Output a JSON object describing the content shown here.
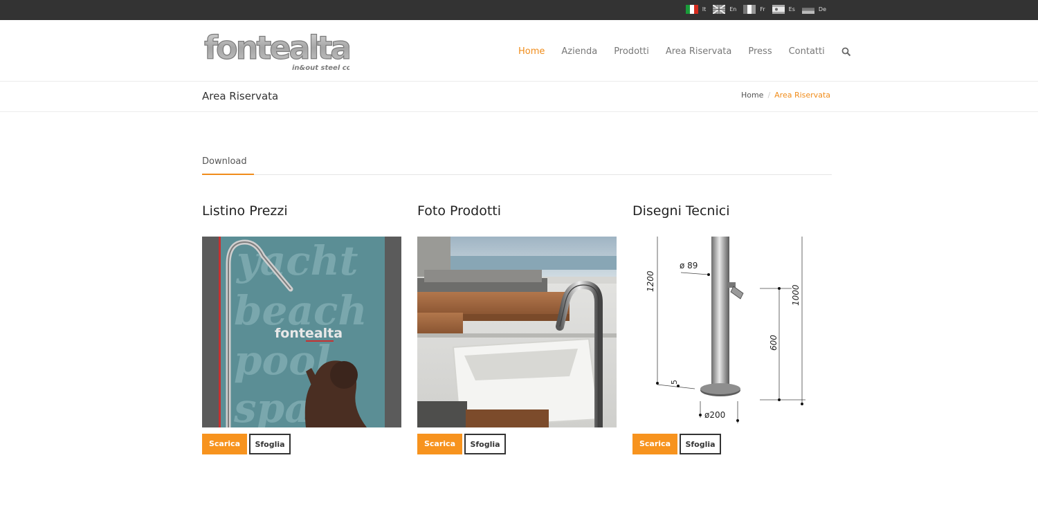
{
  "languages": [
    {
      "code": "It",
      "icon": "italy-flag-icon"
    },
    {
      "code": "En",
      "icon": "uk-flag-icon"
    },
    {
      "code": "Fr",
      "icon": "france-flag-icon"
    },
    {
      "code": "Es",
      "icon": "spain-flag-icon"
    },
    {
      "code": "De",
      "icon": "germany-flag-icon"
    }
  ],
  "logo": {
    "name": "fontealta",
    "tagline": "in&out steel concept"
  },
  "nav": [
    {
      "label": "Home",
      "active": true
    },
    {
      "label": "Azienda"
    },
    {
      "label": "Prodotti"
    },
    {
      "label": "Area Riservata"
    },
    {
      "label": "Press"
    },
    {
      "label": "Contatti"
    }
  ],
  "page_title": "Area Riservata",
  "breadcrumb": {
    "home": "Home",
    "separator": "/",
    "current": "Area Riservata"
  },
  "tabs": [
    {
      "label": "Download"
    }
  ],
  "cards": [
    {
      "title": "Listino Prezzi",
      "download_label": "Scarica",
      "browse_label": "Sfoglia",
      "cover_words": [
        "yacht",
        "beach",
        "pool",
        "spa"
      ],
      "cover_brand": "fontealta"
    },
    {
      "title": "Foto Prodotti",
      "download_label": "Scarica",
      "browse_label": "Sfoglia"
    },
    {
      "title": "Disegni Tecnici",
      "download_label": "Scarica",
      "browse_label": "Sfoglia",
      "dimensions": {
        "d1": "ø 89",
        "h1": "1200",
        "h2": "1000",
        "h3": "600",
        "d2": "ø200",
        "s": "5"
      }
    }
  ],
  "colors": {
    "accent": "#f08c1a",
    "button": "#f7931e",
    "topbar": "#333333"
  }
}
